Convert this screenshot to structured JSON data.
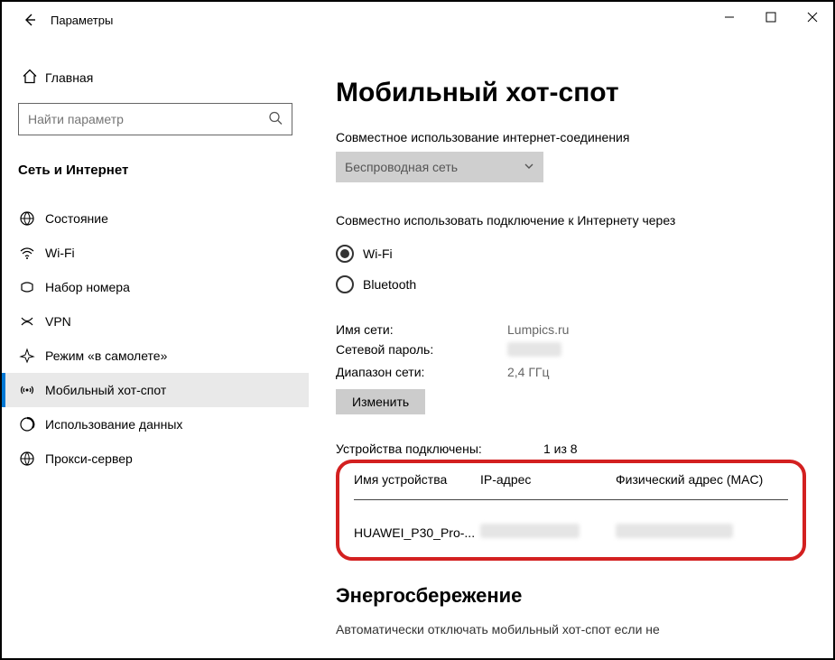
{
  "titlebar": {
    "title": "Параметры"
  },
  "sidebar": {
    "home": "Главная",
    "search_placeholder": "Найти параметр",
    "category": "Сеть и Интернет",
    "items": [
      {
        "label": "Состояние"
      },
      {
        "label": "Wi-Fi"
      },
      {
        "label": "Набор номера"
      },
      {
        "label": "VPN"
      },
      {
        "label": "Режим «в самолете»"
      },
      {
        "label": "Мобильный хот-спот"
      },
      {
        "label": "Использование данных"
      },
      {
        "label": "Прокси-сервер"
      }
    ]
  },
  "content": {
    "heading": "Мобильный хот-спот",
    "share_label": "Совместное использование интернет-соединения",
    "share_value": "Беспроводная сеть",
    "share_over_label": "Совместно использовать подключение к Интернету через",
    "radios": {
      "wifi": "Wi-Fi",
      "bt": "Bluetooth"
    },
    "net_name_label": "Имя сети:",
    "net_name_value": "Lumpics.ru",
    "net_pass_label": "Сетевой пароль:",
    "net_pass_value": "",
    "band_label": "Диапазон сети:",
    "band_value": "2,4 ГГц",
    "edit_btn": "Изменить",
    "devcount_label": "Устройства подключены:",
    "devcount_value": "1 из 8",
    "table": {
      "h1": "Имя устройства",
      "h2": "IP-адрес",
      "h3": "Физический адрес (MAC)",
      "r1c1": "HUAWEI_P30_Pro-..."
    },
    "energy_heading": "Энергосбережение",
    "energy_tail": "Автоматически отключать мобильный хот-спот если не"
  }
}
